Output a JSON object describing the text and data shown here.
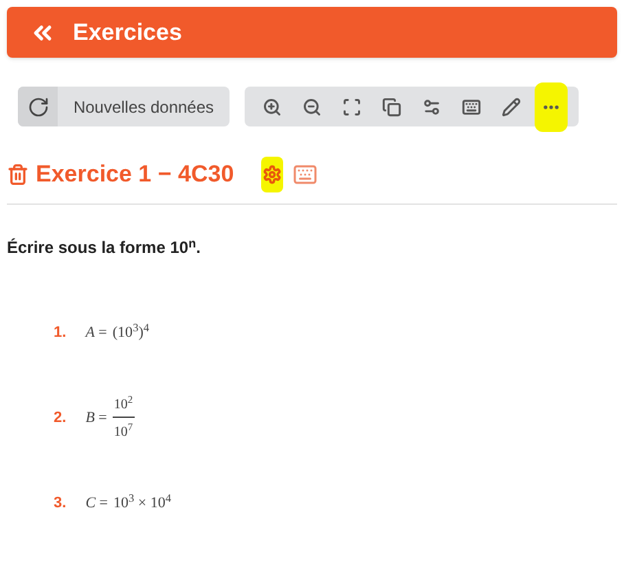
{
  "header": {
    "title": "Exercices"
  },
  "toolbar": {
    "refresh_button": {
      "label": "Nouvelles données"
    },
    "tools": [
      {
        "highlighted": false
      },
      {
        "highlighted": false
      },
      {
        "highlighted": false
      },
      {
        "highlighted": false
      },
      {
        "highlighted": false
      },
      {
        "highlighted": false
      },
      {
        "highlighted": false
      },
      {
        "highlighted": true
      }
    ]
  },
  "exercise": {
    "title": "Exercice 1 − 4C30",
    "settings_highlighted": true,
    "instruction": "Écrire sous la forme 10$^{n}$.",
    "questions": [
      {
        "number": "1.",
        "kind": "expression",
        "lhs": "*A* =",
        "rhs": "(10$^{3}$)$^{4}$"
      },
      {
        "number": "2.",
        "kind": "fraction",
        "lhs": "*B* =",
        "numerator": "10$^{2}$",
        "denominator": "10$^{7}$"
      },
      {
        "number": "3.",
        "kind": "expression",
        "lhs": "*C* =",
        "rhs": "10$^{3}$ × 10$^{4}$"
      }
    ]
  }
}
